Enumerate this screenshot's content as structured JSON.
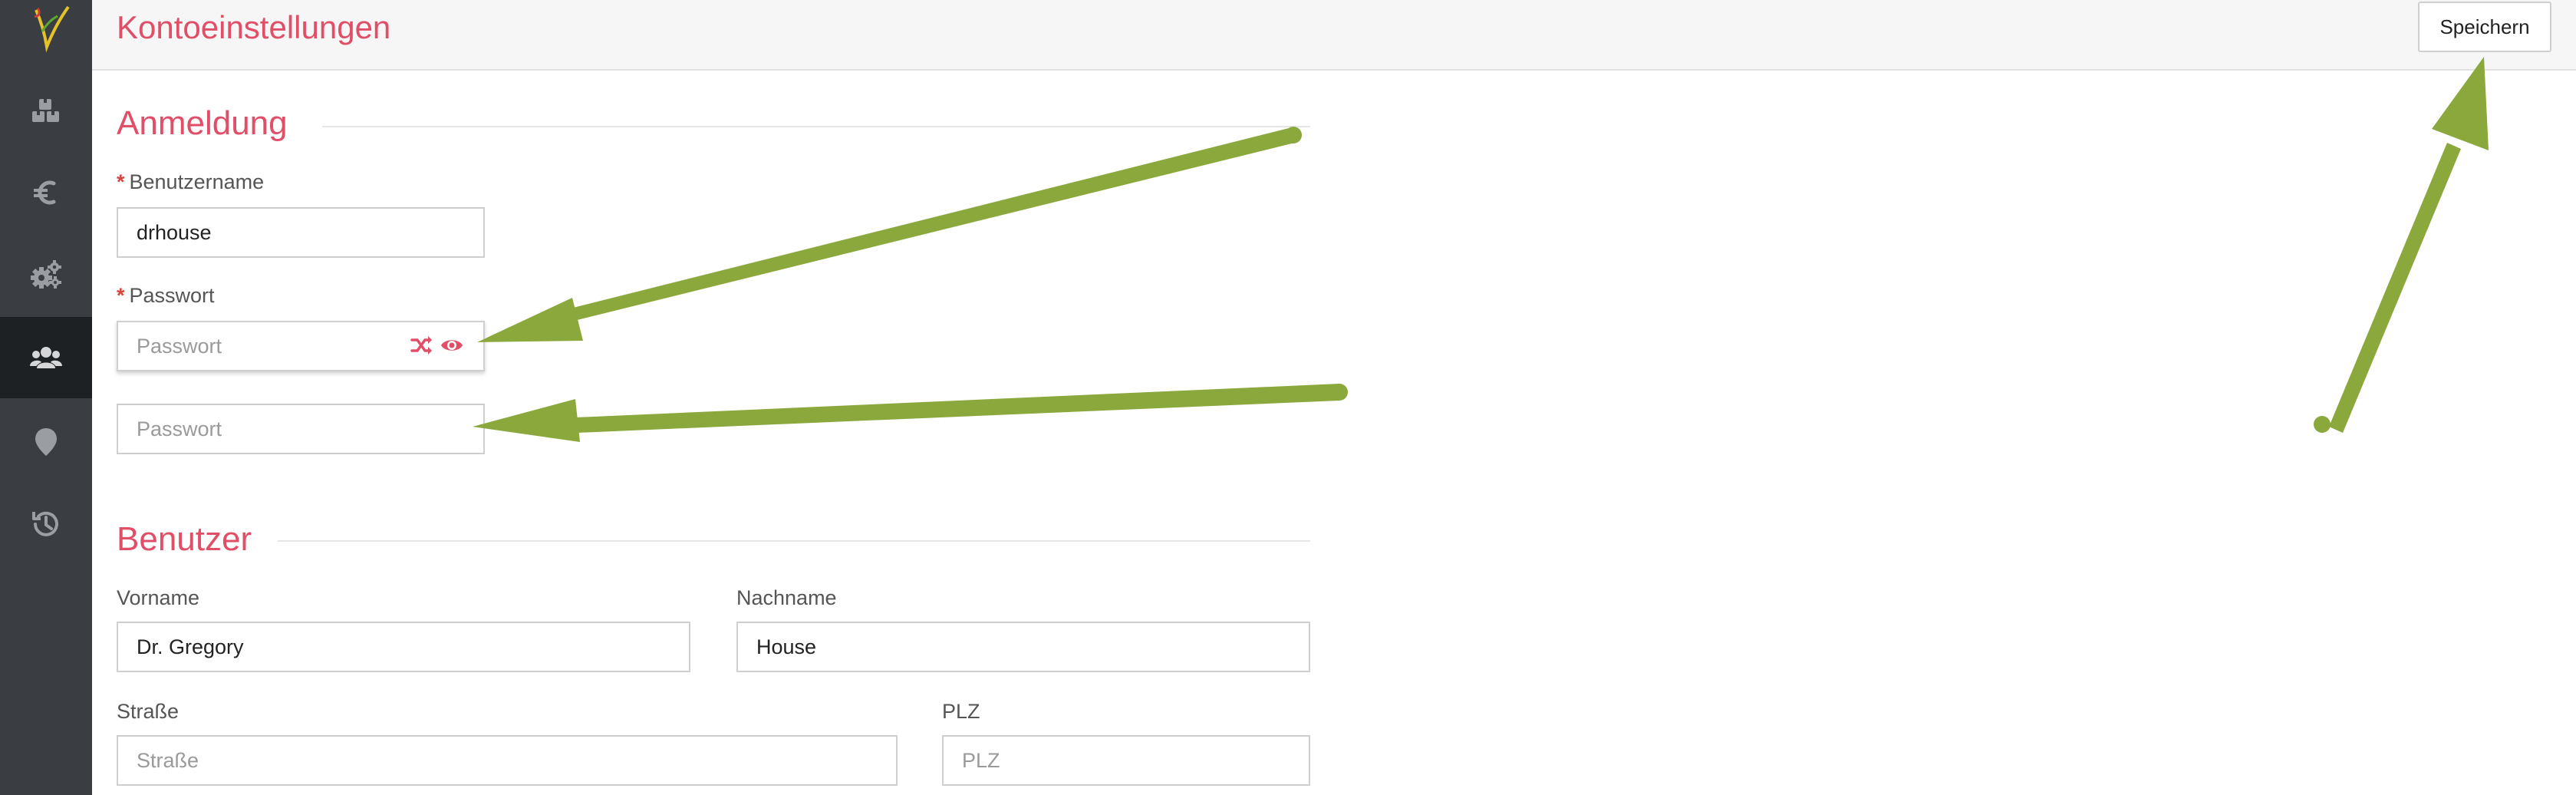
{
  "header": {
    "title": "Kontoeinstellungen",
    "save_label": "Speichern"
  },
  "sidebar": {
    "items": [
      {
        "name": "logo",
        "icon": "logo-icon"
      },
      {
        "name": "products",
        "icon": "boxes-icon",
        "active": false
      },
      {
        "name": "finance",
        "icon": "euro-icon",
        "active": false
      },
      {
        "name": "settings",
        "icon": "gears-icon",
        "active": false
      },
      {
        "name": "users",
        "icon": "users-icon",
        "active": true
      },
      {
        "name": "location",
        "icon": "map-marker-icon",
        "active": false
      },
      {
        "name": "history",
        "icon": "history-icon",
        "active": false
      }
    ]
  },
  "login": {
    "title": "Anmeldung",
    "username_label": "Benutzername",
    "username_value": "drhouse",
    "password_label": "Passwort",
    "password_placeholder": "Passwort",
    "password_confirm_placeholder": "Passwort",
    "required_mark": "*"
  },
  "user": {
    "title": "Benutzer",
    "firstname_label": "Vorname",
    "firstname_value": "Dr. Gregory",
    "lastname_label": "Nachname",
    "lastname_value": "House",
    "street_label": "Straße",
    "street_placeholder": "Straße",
    "zip_label": "PLZ",
    "zip_placeholder": "PLZ"
  },
  "colors": {
    "accent": "#e04e68",
    "sidebar": "#3a3e42",
    "sidebar_active": "#1e2124",
    "annotation_arrow": "#8aa83c"
  }
}
